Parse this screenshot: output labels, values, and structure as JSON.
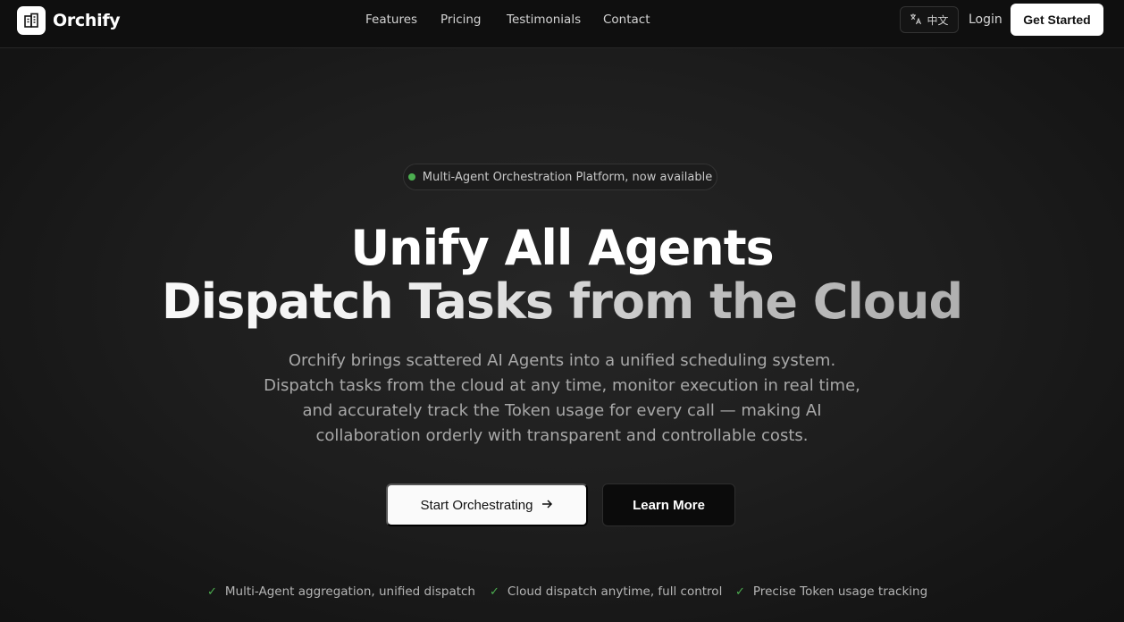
{
  "brand": {
    "name": "Orchify",
    "logo_icon": "building-icon"
  },
  "nav": {
    "links": [
      "Features",
      "Pricing",
      "Testimonials",
      "Contact"
    ],
    "language_label": "中文",
    "language_icon": "translate-icon",
    "login_label": "Login",
    "cta_label": "Get Started"
  },
  "hero": {
    "badge": "Multi-Agent Orchestration Platform, now available",
    "badge_dot_color": "#4caf50",
    "headline_line1": "Unify All Agents",
    "headline_line2": "Dispatch Tasks from the Cloud",
    "description_lines": [
      "Orchify brings scattered AI Agents into a unified scheduling system.",
      "Dispatch tasks from the cloud at any time, monitor execution in real time,",
      "and accurately track the Token usage for every call — making AI",
      "collaboration orderly with transparent and controllable costs."
    ],
    "primary_button": "Start Orchestrating",
    "primary_button_icon": "arrow-right-icon",
    "secondary_button": "Learn More"
  },
  "features": [
    "Multi-Agent aggregation, unified dispatch",
    "Cloud dispatch anytime, full control",
    "Precise Token usage tracking"
  ],
  "colors": {
    "background": "#1a1a1a",
    "accent_green": "#4caf50",
    "button_light": "#fafafa"
  }
}
